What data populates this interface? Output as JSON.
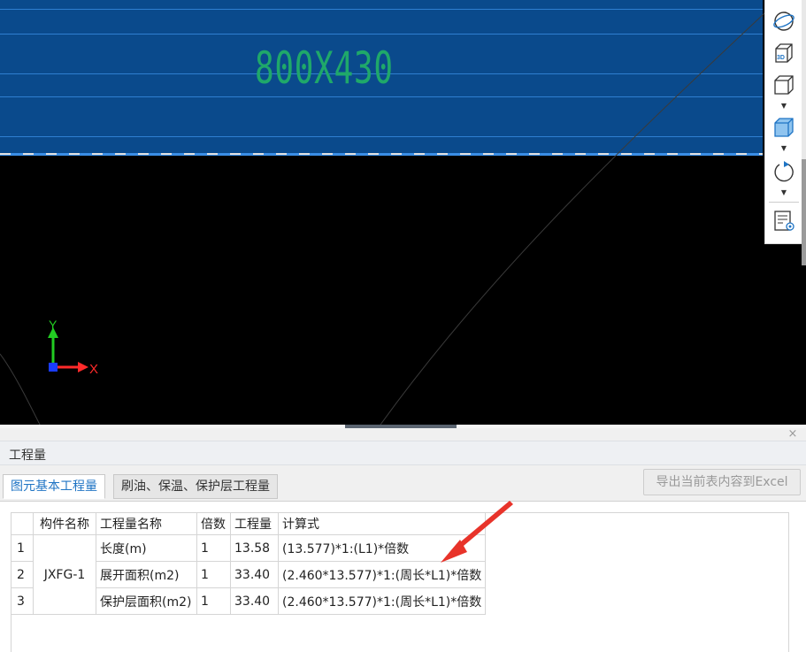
{
  "viewport": {
    "beam_label": "800X430",
    "axis": {
      "y_label": "Y",
      "x_label": "X"
    }
  },
  "toolbar": {
    "buttons": [
      "orbit-icon",
      "view-3d-icon",
      "box-wireframe-icon",
      "box-solid-icon",
      "rotate-icon",
      "report-view-icon"
    ],
    "badge_3d": "3D"
  },
  "panel": {
    "title": "工程量",
    "close": "×",
    "tabs": [
      {
        "label": "图元基本工程量",
        "active": true
      },
      {
        "label": "刷油、保温、保护层工程量",
        "active": false
      }
    ],
    "export_label": "导出当前表内容到Excel"
  },
  "table": {
    "headers": [
      "",
      "构件名称",
      "工程量名称",
      "倍数",
      "工程量",
      "计算式"
    ],
    "component_name": "JXFG-1",
    "rows": [
      {
        "idx": "1",
        "item": "长度(m)",
        "multiplier": "1",
        "qty": "13.58",
        "formula": "(13.577)*1:(L1)*倍数"
      },
      {
        "idx": "2",
        "item": "展开面积(m2)",
        "multiplier": "1",
        "qty": "33.40",
        "formula": "(2.460*13.577)*1:(周长*L1)*倍数"
      },
      {
        "idx": "3",
        "item": "保护层面积(m2)",
        "multiplier": "1",
        "qty": "33.40",
        "formula": "(2.460*13.577)*1:(周长*L1)*倍数"
      }
    ]
  },
  "colors": {
    "beam_fill": "#0a4a8c",
    "beam_label": "#1fa86a",
    "axis_x": "#ff2a2a",
    "axis_y": "#22cc22",
    "active_tab": "#1f74c4",
    "annotation_arrow": "#e8332a"
  }
}
